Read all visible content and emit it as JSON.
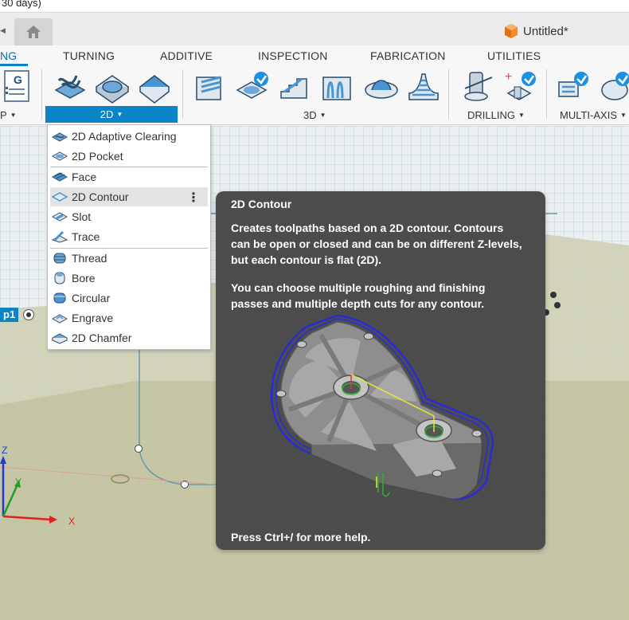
{
  "trial_banner": {
    "text": "30 days)"
  },
  "document": {
    "title": "Untitled*"
  },
  "ribbon": {
    "tabs": [
      {
        "label": "NG",
        "active": true
      },
      {
        "label": "TURNING"
      },
      {
        "label": "ADDITIVE"
      },
      {
        "label": "INSPECTION"
      },
      {
        "label": "FABRICATION"
      },
      {
        "label": "UTILITIES"
      }
    ],
    "groups": {
      "setup": "P",
      "two_d": "2D",
      "three_d": "3D",
      "drilling": "DRILLING",
      "multi_axis": "MULTI-AXIS"
    },
    "accent_color": "#0a84c6"
  },
  "menu": {
    "items": [
      {
        "label": "2D Adaptive Clearing",
        "icon": "adaptive-clearing-icon"
      },
      {
        "label": "2D Pocket",
        "icon": "pocket-icon"
      },
      {
        "label": "Face",
        "icon": "face-icon"
      },
      {
        "label": "2D Contour",
        "icon": "contour-icon",
        "hovered": true
      },
      {
        "label": "Slot",
        "icon": "slot-icon"
      },
      {
        "label": "Trace",
        "icon": "trace-icon"
      },
      {
        "label": "Thread",
        "icon": "thread-icon"
      },
      {
        "label": "Bore",
        "icon": "bore-icon"
      },
      {
        "label": "Circular",
        "icon": "circular-icon"
      },
      {
        "label": "Engrave",
        "icon": "engrave-icon"
      },
      {
        "label": "2D Chamfer",
        "icon": "chamfer-icon"
      }
    ],
    "more_glyph": "⋮"
  },
  "tooltip": {
    "title": "2D Contour",
    "paragraph1": "Creates toolpaths based on a 2D contour. Contours can be open or closed and can be on different Z-levels, but each contour is flat (2D).",
    "paragraph2": "You can choose multiple roughing and finishing passes and multiple depth cuts for any contour.",
    "footer": "Press Ctrl+/ for more help."
  },
  "browser": {
    "setup_label": "p1"
  },
  "axes": {
    "x": "X",
    "y": "Y",
    "z": "Z"
  }
}
